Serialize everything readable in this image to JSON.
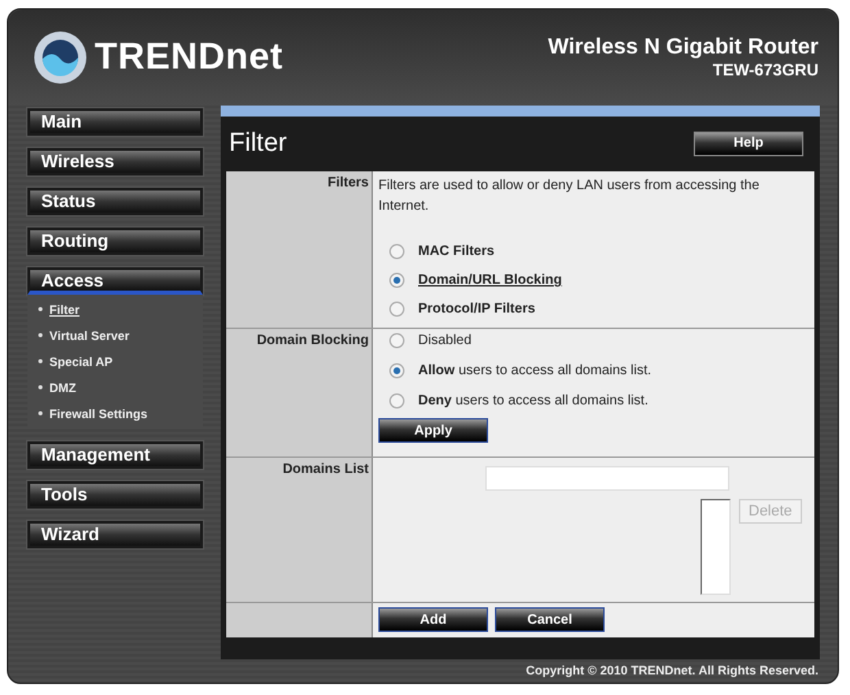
{
  "header": {
    "brand": "TRENDnet",
    "product": "Wireless N Gigabit Router",
    "model": "TEW-673GRU"
  },
  "sidebar": {
    "items": [
      {
        "label": "Main",
        "selected": false
      },
      {
        "label": "Wireless",
        "selected": false
      },
      {
        "label": "Status",
        "selected": false
      },
      {
        "label": "Routing",
        "selected": false
      },
      {
        "label": "Access",
        "selected": true,
        "expanded": true,
        "children": [
          {
            "label": "Filter",
            "selected": true
          },
          {
            "label": "Virtual Server",
            "selected": false
          },
          {
            "label": "Special AP",
            "selected": false
          },
          {
            "label": "DMZ",
            "selected": false
          },
          {
            "label": "Firewall Settings",
            "selected": false
          }
        ]
      },
      {
        "label": "Management",
        "selected": false
      },
      {
        "label": "Tools",
        "selected": false
      },
      {
        "label": "Wizard",
        "selected": false
      }
    ]
  },
  "page": {
    "title": "Filter",
    "help_button": "Help"
  },
  "form": {
    "filters": {
      "label": "Filters",
      "description": "Filters are used to allow or deny LAN users from accessing the Internet.",
      "options": [
        {
          "label": "MAC Filters",
          "selected": false
        },
        {
          "label": "Domain/URL Blocking",
          "selected": true
        },
        {
          "label": "Protocol/IP Filters",
          "selected": false
        }
      ]
    },
    "domain_blocking": {
      "label": "Domain Blocking",
      "options": [
        {
          "label": "Disabled",
          "selected": false
        },
        {
          "label": "**Allow** users to access all domains list.",
          "selected": true
        },
        {
          "label": "**Deny** users to access all domains list.",
          "selected": false
        }
      ],
      "apply_button": "Apply"
    },
    "domains_list": {
      "label": "Domains List",
      "delete_button": {
        "label": "Delete",
        "disabled": true
      }
    },
    "buttons": [
      "Add",
      "Cancel"
    ]
  },
  "copyright": "Copyright © 2010 TRENDnet. All Rights Reserved."
}
